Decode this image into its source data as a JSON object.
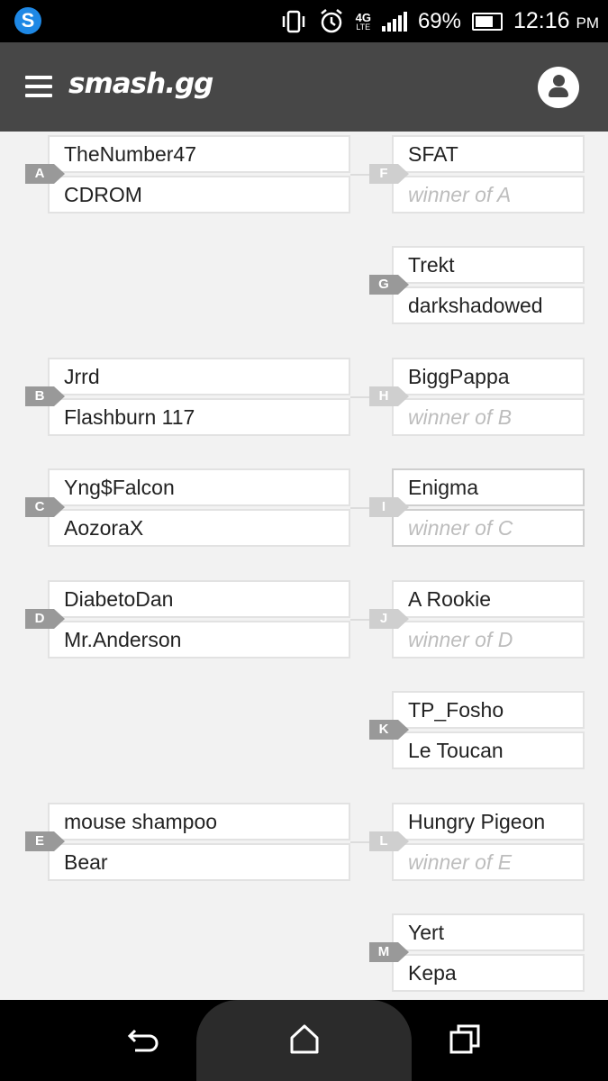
{
  "status_bar": {
    "battery_percent": "69%",
    "time": "12:16",
    "time_suffix": "PM",
    "network": "4G",
    "network_sub": "LTE",
    "icons": [
      "vibrate-icon",
      "alarm-icon",
      "signal-icon",
      "battery-icon"
    ]
  },
  "app_bar": {
    "logo": "smash.gg",
    "menu_icon": "hamburger-menu-icon",
    "account_icon": "user-icon"
  },
  "colors": {
    "app_bar": "#474747",
    "background": "#f2f2f2",
    "tag_active": "#999999",
    "tag_inactive": "#cfcfcf",
    "pending_text": "#bdbdbd"
  },
  "bracket": {
    "round1": [
      {
        "id": "A",
        "players": [
          "TheNumber47",
          "CDROM"
        ]
      },
      {
        "id": "B",
        "players": [
          "Jrrd",
          "Flashburn 117"
        ]
      },
      {
        "id": "C",
        "players": [
          "Yng$Falcon",
          "AozoraX"
        ]
      },
      {
        "id": "D",
        "players": [
          "DiabetoDan",
          "Mr.Anderson"
        ]
      },
      {
        "id": "E",
        "players": [
          "mouse shampoo",
          "Bear"
        ]
      }
    ],
    "round2": [
      {
        "id": "F",
        "players": [
          "SFAT",
          "winner of A"
        ]
      },
      {
        "id": "G",
        "players": [
          "Trekt",
          "darkshadowed"
        ]
      },
      {
        "id": "H",
        "players": [
          "BiggPappa",
          "winner of B"
        ]
      },
      {
        "id": "I",
        "players": [
          "Enigma",
          "winner of C"
        ]
      },
      {
        "id": "J",
        "players": [
          "A Rookie",
          "winner of D"
        ]
      },
      {
        "id": "K",
        "players": [
          "TP_Fosho",
          "Le Toucan"
        ]
      },
      {
        "id": "L",
        "players": [
          "Hungry Pigeon",
          "winner of E"
        ]
      },
      {
        "id": "M",
        "players": [
          "Yert",
          "Kepa"
        ]
      }
    ]
  },
  "nav_bar": {
    "back_icon": "back-icon",
    "home_icon": "home-icon",
    "recents_icon": "recents-icon"
  }
}
